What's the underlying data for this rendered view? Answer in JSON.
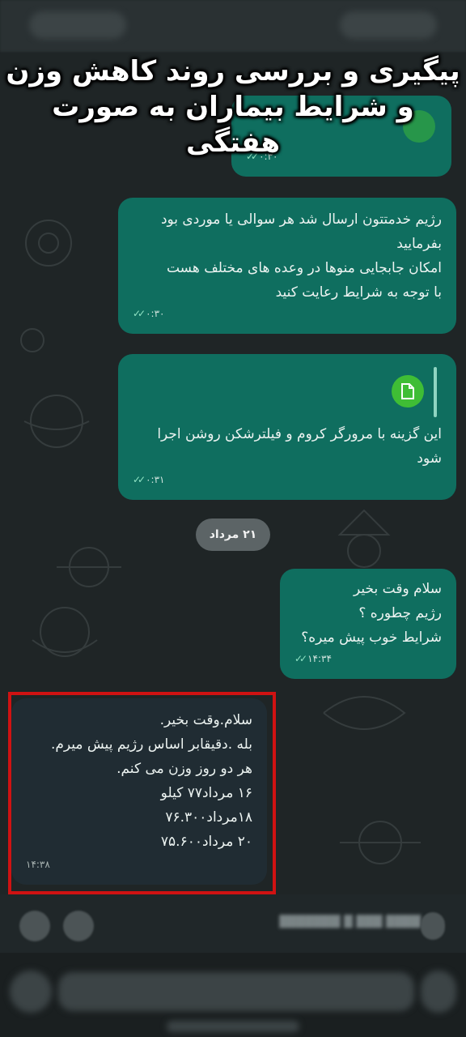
{
  "overlay_title": "پیگیری و بررسی روند کاهش وزن\nو شرایط بیماران به صورت\nهفتگی",
  "messages": {
    "top_partial": {
      "time": "۰:۳۰"
    },
    "m1": {
      "text": "رژیم خدمتتون ارسال شد هر سوالی یا موردی بود\nبفرمایید\nامکان جابجایی منوها در وعده های مختلف هست\nبا توجه به شرایط رعایت کنید",
      "time": "۰:۳۰"
    },
    "m2": {
      "text": "این گزینه با مرورگر کروم و فیلترشکن روشن اجرا\nشود",
      "time": "۰:۳۱",
      "attachment_icon": "document-icon"
    },
    "date_separator": "۲۱ مرداد",
    "m3": {
      "text": "سلام وقت بخیر\nرژیم چطوره ؟\nشرایط خوب پیش میره؟",
      "time": "۱۴:۳۴"
    },
    "m4": {
      "text": "سلام.وقت بخیر.\nبله .دقیقابر اساس رژیم پیش میرم.\nهر دو روز وزن می کنم.\n۱۶ مرداد۷۷ کیلو\n۱۸مرداد۷۶.۳۰۰\n۲۰ مرداد۷۵.۶۰۰",
      "time": "۱۴:۳۸"
    }
  },
  "colors": {
    "outgoing": "#0f6e5f",
    "incoming": "#202c33",
    "highlight": "#d01212",
    "background": "#1f2526"
  }
}
